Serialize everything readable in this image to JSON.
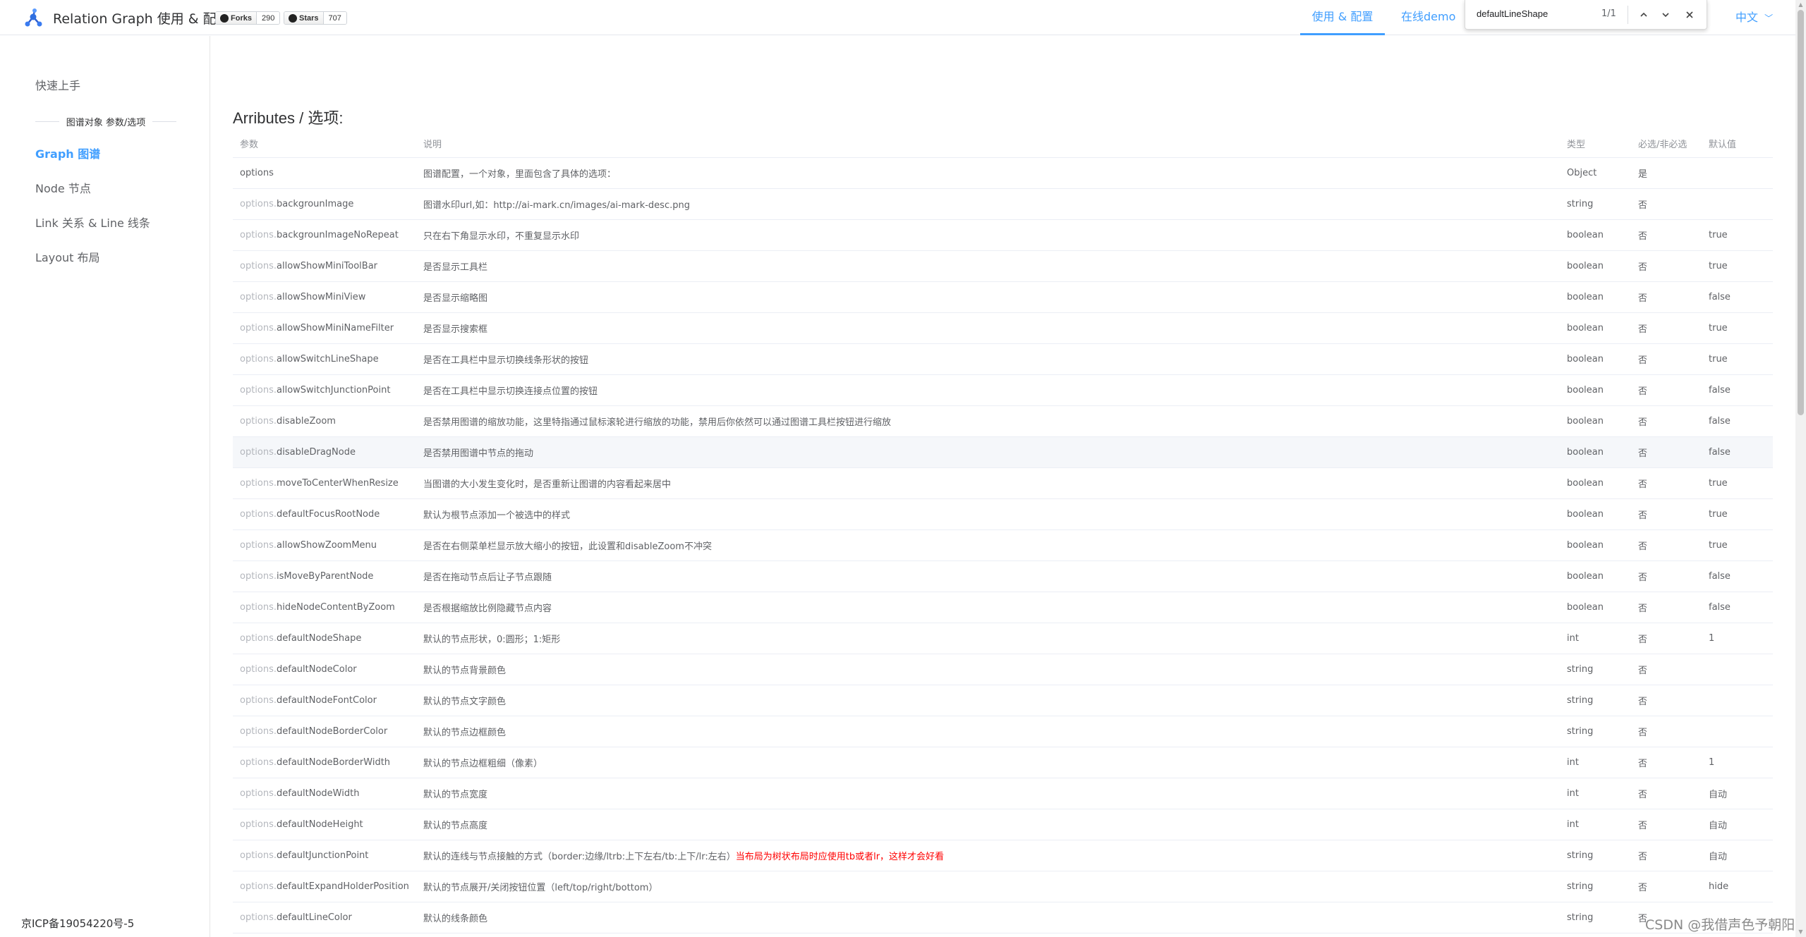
{
  "header": {
    "title": "Relation Graph 使用 & 配置",
    "forks_label": "Forks",
    "forks_count": "290",
    "stars_label": "Stars",
    "stars_count": "707",
    "nav_usage": "使用 & 配置",
    "nav_demo": "在线demo",
    "lang": "中文"
  },
  "findbar": {
    "value": "defaultLineShape",
    "count": "1/1"
  },
  "sidebar": {
    "quickstart": "快速上手",
    "group_title": "图谱对象 参数/选项",
    "items": [
      {
        "label": "Graph 图谱",
        "active": true
      },
      {
        "label": "Node 节点",
        "active": false
      },
      {
        "label": "Link 关系 & Line 线条",
        "active": false
      },
      {
        "label": "Layout 布局",
        "active": false
      }
    ],
    "icp": "京ICP备19054220号-5"
  },
  "main": {
    "title": "Arributes / 选项:",
    "columns": [
      "参数",
      "说明",
      "类型",
      "必选/非必选",
      "默认值"
    ],
    "rows": [
      {
        "prefix": "",
        "name": "options",
        "desc": "图谱配置，一个对象，里面包含了具体的选项：",
        "desc_warn": "",
        "type": "Object",
        "required": "是",
        "default": ""
      },
      {
        "prefix": "options.",
        "name": "backgrounImage",
        "desc": "图谱水印url,如：http://ai-mark.cn/images/ai-mark-desc.png",
        "desc_warn": "",
        "type": "string",
        "required": "否",
        "default": ""
      },
      {
        "prefix": "options.",
        "name": "backgrounImageNoRepeat",
        "desc": "只在右下角显示水印，不重复显示水印",
        "desc_warn": "",
        "type": "boolean",
        "required": "否",
        "default": "true"
      },
      {
        "prefix": "options.",
        "name": "allowShowMiniToolBar",
        "desc": "是否显示工具栏",
        "desc_warn": "",
        "type": "boolean",
        "required": "否",
        "default": "true"
      },
      {
        "prefix": "options.",
        "name": "allowShowMiniView",
        "desc": "是否显示缩略图",
        "desc_warn": "",
        "type": "boolean",
        "required": "否",
        "default": "false"
      },
      {
        "prefix": "options.",
        "name": "allowShowMiniNameFilter",
        "desc": "是否显示搜索框",
        "desc_warn": "",
        "type": "boolean",
        "required": "否",
        "default": "true"
      },
      {
        "prefix": "options.",
        "name": "allowSwitchLineShape",
        "desc": "是否在工具栏中显示切换线条形状的按钮",
        "desc_warn": "",
        "type": "boolean",
        "required": "否",
        "default": "true"
      },
      {
        "prefix": "options.",
        "name": "allowSwitchJunctionPoint",
        "desc": "是否在工具栏中显示切换连接点位置的按钮",
        "desc_warn": "",
        "type": "boolean",
        "required": "否",
        "default": "false"
      },
      {
        "prefix": "options.",
        "name": "disableZoom",
        "desc": "是否禁用图谱的缩放功能，这里特指通过鼠标滚轮进行缩放的功能，禁用后你依然可以通过图谱工具栏按钮进行缩放",
        "desc_warn": "",
        "type": "boolean",
        "required": "否",
        "default": "false"
      },
      {
        "prefix": "options.",
        "name": "disableDragNode",
        "desc": "是否禁用图谱中节点的拖动",
        "desc_warn": "",
        "type": "boolean",
        "required": "否",
        "default": "false",
        "highlight": true
      },
      {
        "prefix": "options.",
        "name": "moveToCenterWhenResize",
        "desc": "当图谱的大小发生变化时，是否重新让图谱的内容看起来居中",
        "desc_warn": "",
        "type": "boolean",
        "required": "否",
        "default": "true"
      },
      {
        "prefix": "options.",
        "name": "defaultFocusRootNode",
        "desc": "默认为根节点添加一个被选中的样式",
        "desc_warn": "",
        "type": "boolean",
        "required": "否",
        "default": "true"
      },
      {
        "prefix": "options.",
        "name": "allowShowZoomMenu",
        "desc": "是否在右侧菜单栏显示放大缩小的按钮，此设置和disableZoom不冲突",
        "desc_warn": "",
        "type": "boolean",
        "required": "否",
        "default": "true"
      },
      {
        "prefix": "options.",
        "name": "isMoveByParentNode",
        "desc": "是否在拖动节点后让子节点跟随",
        "desc_warn": "",
        "type": "boolean",
        "required": "否",
        "default": "false"
      },
      {
        "prefix": "options.",
        "name": "hideNodeContentByZoom",
        "desc": "是否根据缩放比例隐藏节点内容",
        "desc_warn": "",
        "type": "boolean",
        "required": "否",
        "default": "false"
      },
      {
        "prefix": "options.",
        "name": "defaultNodeShape",
        "desc": "默认的节点形状，0:圆形；1:矩形",
        "desc_warn": "",
        "type": "int",
        "required": "否",
        "default": "1"
      },
      {
        "prefix": "options.",
        "name": "defaultNodeColor",
        "desc": "默认的节点背景颜色",
        "desc_warn": "",
        "type": "string",
        "required": "否",
        "default": ""
      },
      {
        "prefix": "options.",
        "name": "defaultNodeFontColor",
        "desc": "默认的节点文字颜色",
        "desc_warn": "",
        "type": "string",
        "required": "否",
        "default": ""
      },
      {
        "prefix": "options.",
        "name": "defaultNodeBorderColor",
        "desc": "默认的节点边框颜色",
        "desc_warn": "",
        "type": "string",
        "required": "否",
        "default": ""
      },
      {
        "prefix": "options.",
        "name": "defaultNodeBorderWidth",
        "desc": "默认的节点边框粗细（像素）",
        "desc_warn": "",
        "type": "int",
        "required": "否",
        "default": "1"
      },
      {
        "prefix": "options.",
        "name": "defaultNodeWidth",
        "desc": "默认的节点宽度",
        "desc_warn": "",
        "type": "int",
        "required": "否",
        "default": "自动"
      },
      {
        "prefix": "options.",
        "name": "defaultNodeHeight",
        "desc": "默认的节点高度",
        "desc_warn": "",
        "type": "int",
        "required": "否",
        "default": "自动"
      },
      {
        "prefix": "options.",
        "name": "defaultJunctionPoint",
        "desc": "默认的连线与节点接触的方式（border:边缘/ltrb:上下左右/tb:上下/lr:左右）",
        "desc_warn": "当布局为树状布局时应使用tb或者lr，这样才会好看",
        "type": "string",
        "required": "否",
        "default": "自动"
      },
      {
        "prefix": "options.",
        "name": "defaultExpandHolderPosition",
        "desc": "默认的节点展开/关闭按钮位置（left/top/right/bottom）",
        "desc_warn": "",
        "type": "string",
        "required": "否",
        "default": "hide"
      },
      {
        "prefix": "options.",
        "name": "defaultLineColor",
        "desc": "默认的线条颜色",
        "desc_warn": "",
        "type": "string",
        "required": "否",
        "default": ""
      }
    ]
  },
  "watermark": "CSDN @我借声色予朝阳",
  "colors": {
    "accent": "#409eff",
    "warn": "#ff0000"
  }
}
